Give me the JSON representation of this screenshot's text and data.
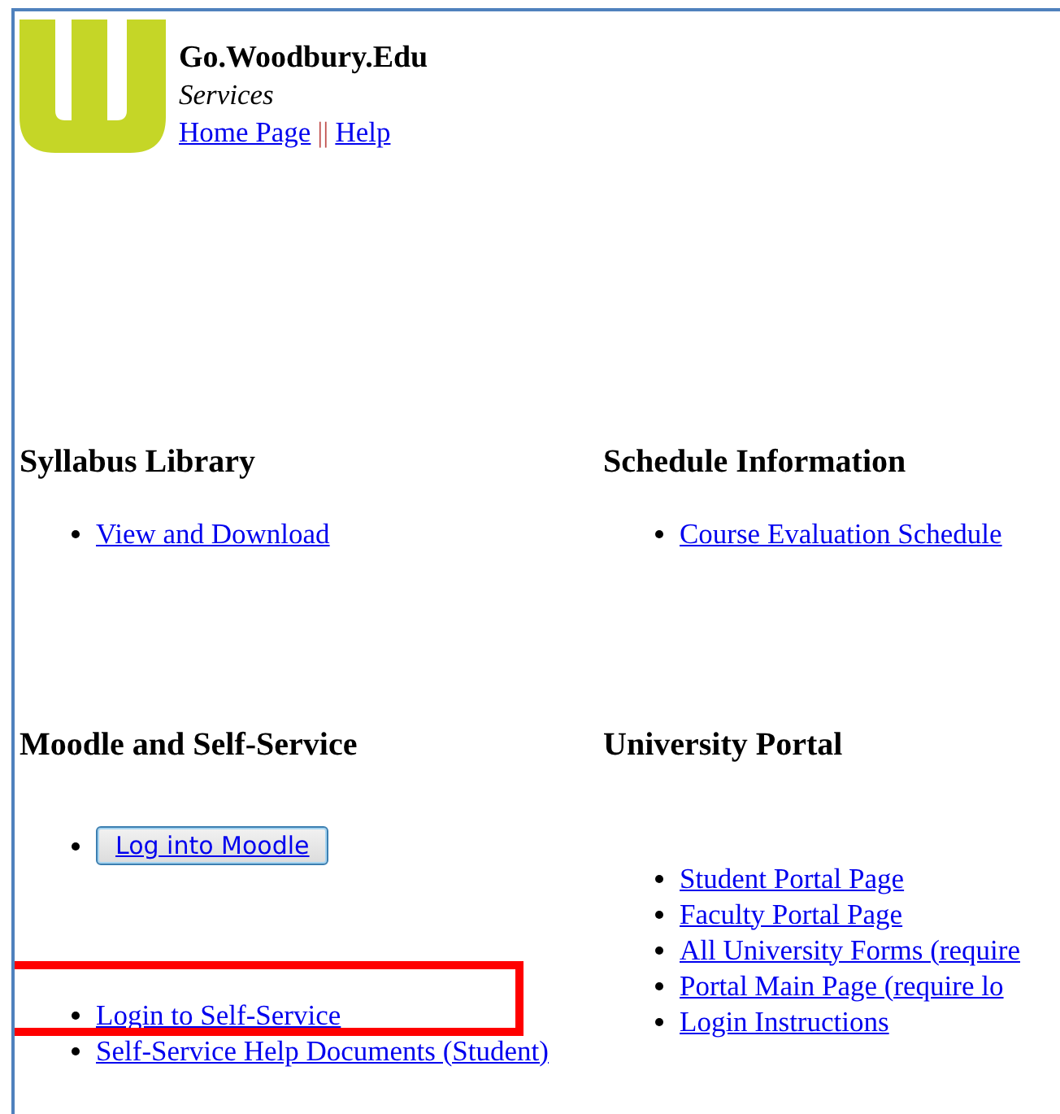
{
  "header": {
    "title": "Go.Woodbury.Edu",
    "subtitle": "Services",
    "links": [
      "Home Page",
      "Help"
    ],
    "separator": "||"
  },
  "sections": [
    {
      "heading": "Syllabus Library",
      "items": [
        {
          "kind": "link",
          "label": "View and Download"
        }
      ]
    },
    {
      "heading": "Schedule Information",
      "items": [
        {
          "kind": "link",
          "label": "Course Evaluation Schedule"
        }
      ]
    },
    {
      "heading": "Moodle and Self-Service",
      "items": [
        {
          "kind": "button",
          "label": "Log into Moodle"
        },
        {
          "kind": "link",
          "label": "Login to Self-Service",
          "highlighted": true
        },
        {
          "kind": "link",
          "label": "Self-Service Help Documents (Student)",
          "highlighted": false
        }
      ]
    },
    {
      "heading": "University Portal",
      "items": [
        {
          "kind": "link",
          "label": "Student Portal Page"
        },
        {
          "kind": "link",
          "label": "Faculty Portal Page"
        },
        {
          "kind": "link",
          "label": "All University Forms (require"
        },
        {
          "kind": "link",
          "label": "Portal Main Page (require lo"
        },
        {
          "kind": "link",
          "label": "Login Instructions"
        }
      ]
    }
  ]
}
